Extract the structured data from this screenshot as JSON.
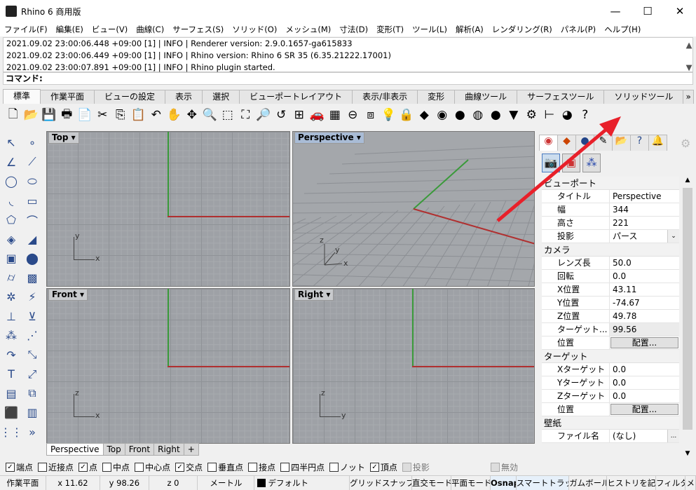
{
  "window": {
    "title": "Rhino 6 商用版",
    "minimize": "—",
    "maximize": "☐",
    "close": "✕"
  },
  "menu": [
    "ファイル(F)",
    "編集(E)",
    "ビュー(V)",
    "曲線(C)",
    "サーフェス(S)",
    "ソリッド(O)",
    "メッシュ(M)",
    "寸法(D)",
    "変形(T)",
    "ツール(L)",
    "解析(A)",
    "レンダリング(R)",
    "パネル(P)",
    "ヘルプ(H)"
  ],
  "log": [
    "2021.09.02 23:00:06.448 +09:00 [1] | INFO | Renderer version: 2.9.0.1657-ga615833",
    "2021.09.02 23:00:06.449 +09:00 [1] | INFO | Rhino version: Rhino 6 SR 35 (6.35.21222.17001)",
    "2021.09.02 23:00:07.891 +09:00 [1] | INFO | Rhino plugin started."
  ],
  "command": {
    "label": "コマンド:"
  },
  "tabs": [
    "標準",
    "作業平面",
    "ビューの設定",
    "表示",
    "選択",
    "ビューポートレイアウト",
    "表示/非表示",
    "変形",
    "曲線ツール",
    "サーフェスツール",
    "ソリッドツール"
  ],
  "tabs_more": "»",
  "toolbar": [
    [
      "new-file-icon",
      "🗋"
    ],
    [
      "open-folder-icon",
      "📂"
    ],
    [
      "save-icon",
      "💾"
    ],
    [
      "print-icon",
      "🖶"
    ],
    [
      "import-icon",
      "📄"
    ],
    [
      "cut-icon",
      "✂"
    ],
    [
      "copy-icon",
      "⎘"
    ],
    [
      "paste-icon",
      "📋"
    ],
    [
      "undo-icon",
      "↶"
    ],
    [
      "pan-hand-icon",
      "✋"
    ],
    [
      "rotate-view-icon",
      "✥"
    ],
    [
      "zoom-icon",
      "🔍"
    ],
    [
      "zoom-window-icon",
      "⬚"
    ],
    [
      "zoom-extents-icon",
      "⛶"
    ],
    [
      "zoom-selected-icon",
      "🔎"
    ],
    [
      "undo-view-icon",
      "↺"
    ],
    [
      "four-viewports-icon",
      "⊞"
    ],
    [
      "named-view-icon",
      "🚗"
    ],
    [
      "cplane-icon",
      "▦"
    ],
    [
      "set-view-icon",
      "⊖"
    ],
    [
      "properties-icon",
      "⧈"
    ],
    [
      "light-icon",
      "💡"
    ],
    [
      "lock-icon",
      "🔒"
    ],
    [
      "layer-icon",
      "◆"
    ],
    [
      "color-wheel-icon",
      "◉"
    ],
    [
      "shaded-sphere-icon",
      "●"
    ],
    [
      "ghosted-sphere-icon",
      "◍"
    ],
    [
      "render-sphere-icon",
      "●"
    ],
    [
      "rendered-icon",
      "▼"
    ],
    [
      "options-gear-icon",
      "⚙"
    ],
    [
      "dimension-icon",
      "⊢"
    ],
    [
      "plugin-globe-icon",
      "◕"
    ],
    [
      "help-icon",
      "?"
    ]
  ],
  "left_toolbar": [
    [
      "select-icon",
      "↖"
    ],
    [
      "point-icon",
      "∘"
    ],
    [
      "polyline-icon",
      "∠"
    ],
    [
      "line-icon",
      "⟋"
    ],
    [
      "circle-icon",
      "◯"
    ],
    [
      "ellipse-icon",
      "⬭"
    ],
    [
      "arc-icon",
      "◟"
    ],
    [
      "rectangle-icon",
      "▭"
    ],
    [
      "polygon-icon",
      "⬠"
    ],
    [
      "fillet-icon",
      "⌒"
    ],
    [
      "surface-icon",
      "◈"
    ],
    [
      "sweep-icon",
      "◢"
    ],
    [
      "box-icon",
      "▣"
    ],
    [
      "sphere-icon",
      "⬤"
    ],
    [
      "extrude-icon",
      "⌭"
    ],
    [
      "mesh-icon",
      "▩"
    ],
    [
      "transform-icon",
      "✲"
    ],
    [
      "split-icon",
      "⚡"
    ],
    [
      "trim-icon",
      "⊥"
    ],
    [
      "join-icon",
      "⊻"
    ],
    [
      "boolean-icon",
      "⁂"
    ],
    [
      "points-icon",
      "⋰"
    ],
    [
      "fillet-edge-icon",
      "↷"
    ],
    [
      "dim-icon",
      "⤡"
    ],
    [
      "text-icon",
      "T"
    ],
    [
      "scale-icon",
      "⤢"
    ],
    [
      "group-icon",
      "▤"
    ],
    [
      "block-icon",
      "⧉"
    ],
    [
      "solid-box-icon",
      "⬛"
    ],
    [
      "hatch-icon",
      "▥"
    ],
    [
      "grid-icon",
      "⋮⋮"
    ],
    [
      "more-icon",
      "»"
    ]
  ],
  "viewports": {
    "top": "Top",
    "perspective": "Perspective",
    "front": "Front",
    "right": "Right",
    "axes": {
      "x": "x",
      "y": "y",
      "z": "z"
    }
  },
  "viewport_tabs": [
    "Perspective",
    "Top",
    "Front",
    "Right",
    "+"
  ],
  "osnap": [
    {
      "label": "端点",
      "checked": true
    },
    {
      "label": "近接点",
      "checked": false
    },
    {
      "label": "点",
      "checked": true
    },
    {
      "label": "中点",
      "checked": false
    },
    {
      "label": "中心点",
      "checked": false
    },
    {
      "label": "交点",
      "checked": true
    },
    {
      "label": "垂直点",
      "checked": false
    },
    {
      "label": "接点",
      "checked": false
    },
    {
      "label": "四半円点",
      "checked": false
    },
    {
      "label": "ノット",
      "checked": false
    },
    {
      "label": "頂点",
      "checked": true
    },
    {
      "label": "投影",
      "checked": false,
      "disabled": true
    },
    {
      "label": "無効",
      "checked": false,
      "disabled": true
    }
  ],
  "status": [
    "作業平面",
    "x 11.62",
    "y 98.26",
    "z 0",
    "メートル",
    "デフォルト",
    "グリッドスナップ",
    "直交モード",
    "平面モード",
    "Osnap",
    "スマートトラック",
    "ガムボール",
    "ヒストリを記録",
    "フィルタ",
    "メ"
  ],
  "panel": {
    "sections": [
      {
        "title": "ビューポート",
        "rows": [
          {
            "k": "タイトル",
            "v": "Perspective"
          },
          {
            "k": "幅",
            "v": "344"
          },
          {
            "k": "高さ",
            "v": "221"
          },
          {
            "k": "投影",
            "v": "パース",
            "type": "dropdown"
          }
        ]
      },
      {
        "title": "カメラ",
        "rows": [
          {
            "k": "レンズ長",
            "v": "50.0"
          },
          {
            "k": "回転",
            "v": "0.0"
          },
          {
            "k": "X位置",
            "v": "43.11"
          },
          {
            "k": "Y位置",
            "v": "-74.67"
          },
          {
            "k": "Z位置",
            "v": "49.78"
          },
          {
            "k": "ターゲット...",
            "v": "99.56",
            "type": "readonly"
          },
          {
            "k": "位置",
            "v": "配置...",
            "type": "button"
          }
        ]
      },
      {
        "title": "ターゲット",
        "rows": [
          {
            "k": "Xターゲット",
            "v": "0.0"
          },
          {
            "k": "Yターゲット",
            "v": "0.0"
          },
          {
            "k": "Zターゲット",
            "v": "0.0"
          },
          {
            "k": "位置",
            "v": "配置...",
            "type": "button"
          }
        ]
      },
      {
        "title": "壁紙",
        "rows": [
          {
            "k": "ファイル名",
            "v": "(なし)",
            "type": "browse",
            "btn": "..."
          }
        ]
      }
    ]
  },
  "colors": {
    "accent_arrow": "#e8202a",
    "viewport_bg": "#9ea1a6",
    "x_axis": "#b03030",
    "y_axis": "#3a9a3a"
  }
}
